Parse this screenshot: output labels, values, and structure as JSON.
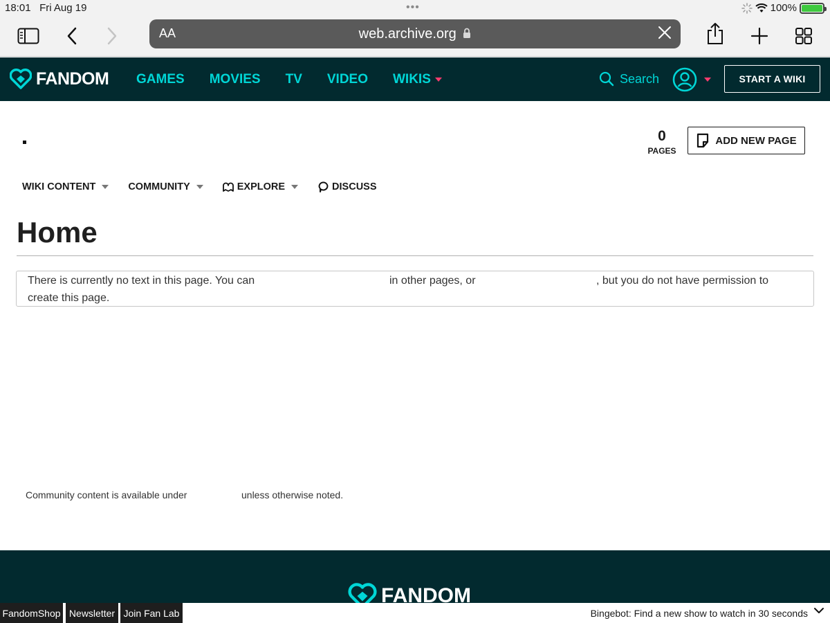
{
  "status": {
    "time": "18:01",
    "date": "Fri Aug 19",
    "battery": "100%",
    "battery_level": 1.0
  },
  "browser": {
    "text_size_label": "AA",
    "url": "web.archive.org",
    "icons": [
      "sidebar-icon",
      "back-icon",
      "forward-icon",
      "lock-icon",
      "clear-icon",
      "share-icon",
      "new-tab-icon",
      "tabs-overview-icon"
    ]
  },
  "nav": {
    "logo": "FANDOM",
    "links": [
      {
        "label": "GAMES"
      },
      {
        "label": "MOVIES"
      },
      {
        "label": "TV"
      },
      {
        "label": "VIDEO"
      },
      {
        "label": "WIKIS"
      }
    ],
    "search_label": "Search",
    "start_wiki": "START A WIKI"
  },
  "wiki": {
    "name": ".",
    "pages_count": "0",
    "pages_label": "PAGES",
    "add_page": "ADD NEW PAGE",
    "tabs": [
      {
        "label": "WIKI CONTENT"
      },
      {
        "label": "COMMUNITY"
      },
      {
        "label": "EXPLORE"
      },
      {
        "label": "DISCUSS"
      }
    ]
  },
  "page": {
    "title": "Home",
    "notice": {
      "part1": "There is currently no text in this page. You can",
      "part2": "in other pages, or",
      "part3": ", but you do not have permission to",
      "part4": "create this page."
    },
    "license": {
      "before": "Community content is available under",
      "after": "unless otherwise noted."
    }
  },
  "footer": {
    "logo": "FANDOM"
  },
  "bottom_bar": {
    "buttons": [
      {
        "label": "FandomShop"
      },
      {
        "label": "Newsletter"
      },
      {
        "label": "Join Fan Lab"
      }
    ],
    "bingebot": "Bingebot: Find a new show to watch in 30 seconds"
  },
  "colors": {
    "accent": "#00d6d6",
    "nav_bg": "#022a2f",
    "caret": "#fe3b6e"
  }
}
